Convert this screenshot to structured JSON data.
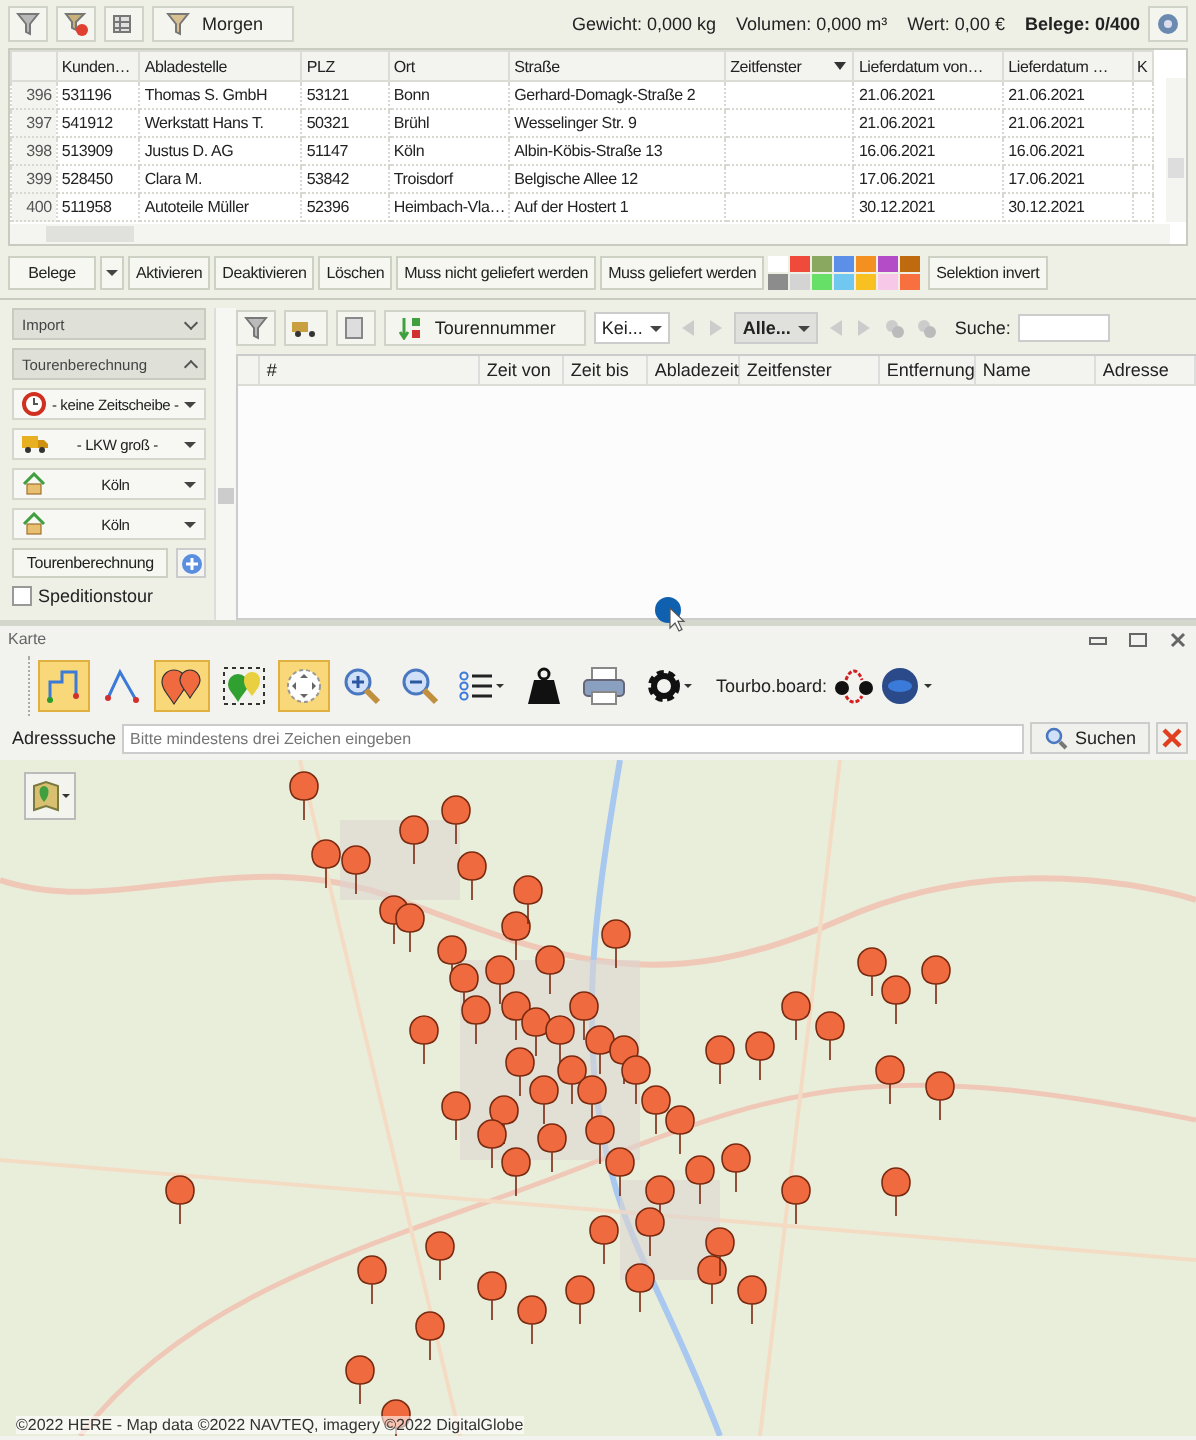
{
  "toolbar": {
    "preset_button": "Morgen",
    "stats": [
      "Gewicht: 0,000 kg",
      "Volumen: 0,000 m³",
      "Wert: 0,00 €"
    ],
    "count": "Belege: 0/400"
  },
  "orders_table": {
    "columns": [
      {
        "label": "Kunden…",
        "kind": "plain"
      },
      {
        "label": "Abladestelle",
        "kind": "plain"
      },
      {
        "label": "PLZ",
        "kind": "plain"
      },
      {
        "label": "Ort",
        "kind": "plain"
      },
      {
        "label": "Straße",
        "kind": "plain"
      },
      {
        "label": "Zeitfenster",
        "kind": "filter"
      },
      {
        "label": "Lieferdatum von…",
        "kind": "plain"
      },
      {
        "label": "Lieferdatum …",
        "kind": "plain"
      },
      {
        "label": "K",
        "kind": "plain"
      }
    ],
    "rows": [
      {
        "number": "396",
        "cells": [
          "531196",
          "Thomas S. GmbH",
          "53121",
          "Bonn",
          "Gerhard-Domagk-Straße 2",
          "",
          "21.06.2021",
          "21.06.2021",
          ""
        ]
      },
      {
        "number": "397",
        "cells": [
          "541912",
          "Werkstatt Hans T.",
          "50321",
          "Brühl",
          "Wesselinger Str. 9",
          "",
          "21.06.2021",
          "21.06.2021",
          ""
        ]
      },
      {
        "number": "398",
        "cells": [
          "513909",
          "Justus D. AG",
          "51147",
          "Köln",
          "Albin-Köbis-Straße 13",
          "",
          "16.06.2021",
          "16.06.2021",
          ""
        ]
      },
      {
        "number": "399",
        "cells": [
          "528450",
          "Clara M.",
          "53842",
          "Troisdorf",
          "Belgische Allee 12",
          "",
          "17.06.2021",
          "17.06.2021",
          ""
        ]
      },
      {
        "number": "400",
        "cells": [
          "511958",
          "Autoteile Müller",
          "52396",
          "Heimbach-Vla…",
          "Auf der Hostert 1",
          "",
          "30.12.2021",
          "30.12.2021",
          ""
        ]
      }
    ]
  },
  "actions": {
    "menu_button": "Belege",
    "buttons": [
      "Aktivieren",
      "Deaktivieren",
      "Löschen",
      "Muss nicht geliefert werden",
      "Muss geliefert werden"
    ],
    "swatches": [
      {
        "color": "#ffffff"
      },
      {
        "color": "#f04a3a"
      },
      {
        "color": "#8aa860"
      },
      {
        "color": "#5b8fe8"
      },
      {
        "color": "#f39020"
      },
      {
        "color": "#b44cc8"
      },
      {
        "color": "#c06a10"
      },
      {
        "color": "#8c8c8c"
      },
      {
        "color": "#d4d4d4"
      },
      {
        "color": "#66e066"
      },
      {
        "color": "#70c8f0"
      },
      {
        "color": "#f8c020"
      },
      {
        "color": "#f8c8e8"
      },
      {
        "color": "#f87040"
      }
    ],
    "invert_button": "Selektion invert"
  },
  "sidebar": {
    "sections": [
      {
        "label": "Import",
        "expanded": false
      },
      {
        "label": "Tourenberechnung",
        "expanded": true
      }
    ],
    "dropdowns": [
      {
        "kind": "clock",
        "value": "- keine Zeitscheibe -"
      },
      {
        "kind": "truck",
        "value": "- LKW groß -"
      },
      {
        "kind": "house",
        "value": "Köln"
      },
      {
        "kind": "house",
        "value": "Köln"
      }
    ],
    "calculate_button": "Tourenberechnung",
    "forwarding_checkbox": {
      "label": "Speditionstour",
      "checked": false
    }
  },
  "tours": {
    "sort_button": "Tourennummer",
    "tour_combo": "Kei...",
    "filter_combo": "Alle...",
    "search_label": "Suche:",
    "columns": [
      "#",
      "Zeit von",
      "Zeit bis",
      "Abladezeit",
      "Zeitfenster",
      "Entfernung",
      "Name",
      "Adresse"
    ]
  },
  "map_window": {
    "title": "Karte",
    "tools": [
      {
        "kind": "route",
        "selected": true
      },
      {
        "kind": "lines",
        "selected": false
      },
      {
        "kind": "pins",
        "selected": true
      },
      {
        "kind": "pinselect",
        "selected": false
      },
      {
        "kind": "pan",
        "selected": true
      },
      {
        "kind": "zoomin",
        "selected": false
      },
      {
        "kind": "zoomout",
        "selected": false
      },
      {
        "kind": "list",
        "selected": false
      },
      {
        "kind": "weight",
        "selected": false
      },
      {
        "kind": "print",
        "selected": false
      },
      {
        "kind": "gear",
        "selected": false
      }
    ],
    "board_label": "Tourbo.board:",
    "address_label": "Adresssuche",
    "address_placeholder": "Bitte mindestens drei Zeichen eingeben",
    "search_button": "Suchen",
    "copyright": "©2022 HERE - Map data ©2022 NAVTEQ, imagery ©2022 DigitalGlobe"
  }
}
